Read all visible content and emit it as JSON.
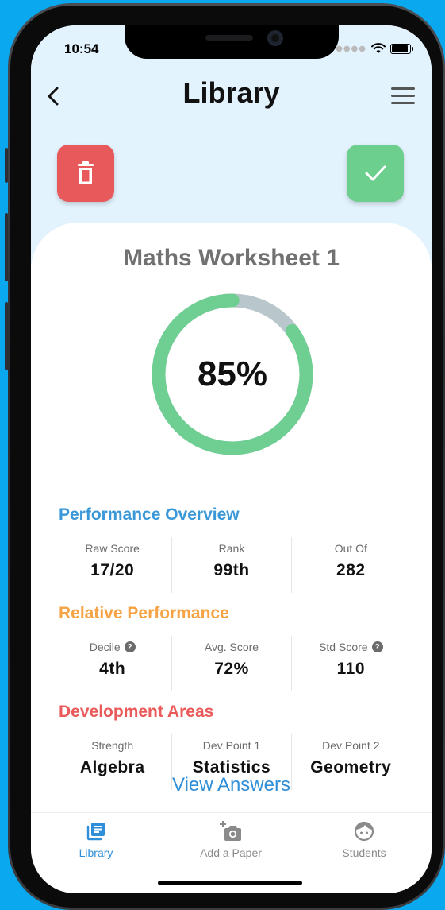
{
  "status_bar": {
    "time": "10:54"
  },
  "header": {
    "title": "Library"
  },
  "actions": {
    "delete_icon": "trash-icon",
    "confirm_icon": "check-icon"
  },
  "worksheet": {
    "title": "Maths Worksheet 1",
    "score_percent": 85,
    "score_label": "85%"
  },
  "sections": [
    {
      "title": "Performance Overview",
      "color": "#3a98d8",
      "stats": [
        {
          "label": "Raw Score",
          "value": "17/20"
        },
        {
          "label": "Rank",
          "value": "99th"
        },
        {
          "label": "Out Of",
          "value": "282"
        }
      ]
    },
    {
      "title": "Relative Performance",
      "color": "#f5a345",
      "stats": [
        {
          "label": "Decile",
          "value": "4th",
          "help": true
        },
        {
          "label": "Avg. Score",
          "value": "72%"
        },
        {
          "label": "Std Score",
          "value": "110",
          "help": true
        }
      ]
    },
    {
      "title": "Development Areas",
      "color": "#ea5a5a",
      "stats": [
        {
          "label": "Strength",
          "value": "Algebra"
        },
        {
          "label": "Dev Point 1",
          "value": "Statistics"
        },
        {
          "label": "Dev Point 2",
          "value": "Geometry"
        }
      ]
    }
  ],
  "view_answers": "View Answers",
  "tabs": [
    {
      "label": "Library",
      "icon": "library-icon",
      "active": true
    },
    {
      "label": "Add a Paper",
      "icon": "add-photo-icon",
      "active": false
    },
    {
      "label": "Students",
      "icon": "student-face-icon",
      "active": false
    }
  ],
  "colors": {
    "accent": "#2f8fd8",
    "ring_fill": "#6fcf93",
    "ring_track": "#b9c6cc",
    "delete": "#e8595c",
    "confirm": "#6ccf8e",
    "inactive": "#8a8a8a"
  }
}
